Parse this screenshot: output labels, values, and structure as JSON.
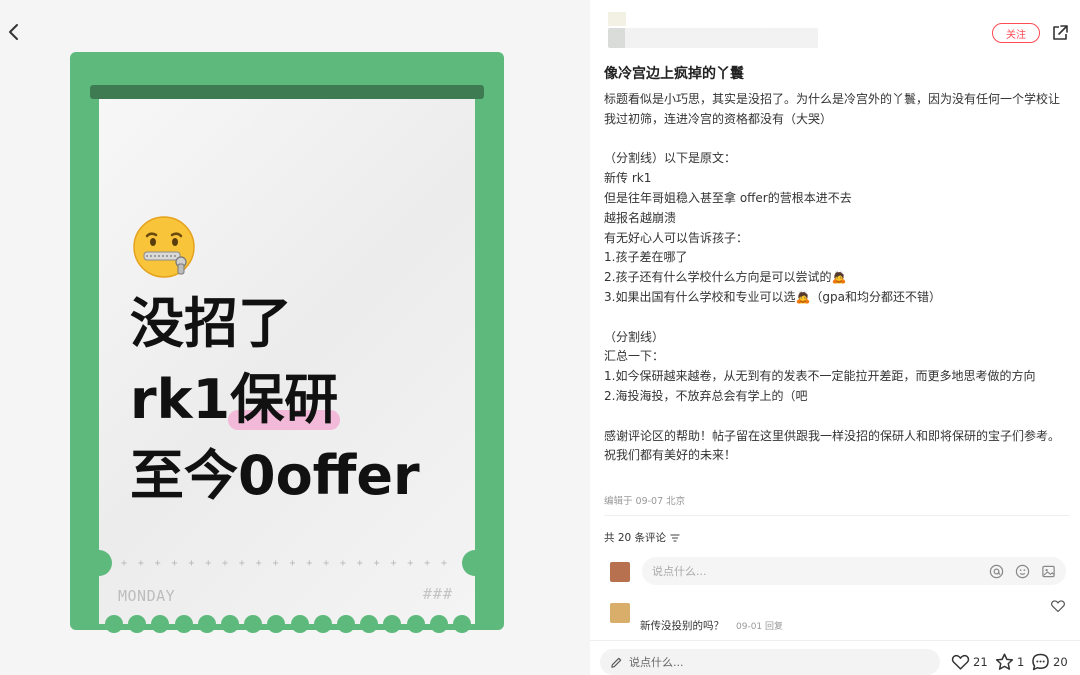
{
  "image_card": {
    "emoji": "🤐",
    "line1": "没招了",
    "line2_prefix": "rk1",
    "line2_highlight": "保研",
    "line3": "至今0offer",
    "plus_line": "+ + + + + + + + + + + + + + + + + + + + + + + + + + + + + + + + + + + + + + + + + + + +",
    "footer_left": "MONDAY",
    "footer_right": "###"
  },
  "header": {
    "follow_label": "关注"
  },
  "post": {
    "title": "像冷宫边上疯掉的丫鬟",
    "body": "标题看似是小巧思，其实是没招了。为什么是冷宫外的丫鬟，因为没有任何一个学校让我过初筛，连进冷宫的资格都没有（大哭）\n\n（分割线）以下是原文：\n新传 rk1\n但是往年哥姐稳入甚至拿 offer的营根本进不去\n越报名越崩溃\n有无好心人可以告诉孩子：\n1.孩子差在哪了\n2.孩子还有什么学校什么方向是可以尝试的🙇\n3.如果出国有什么学校和专业可以选🙇（gpa和均分都还不错）\n\n（分割线）\n汇总一下：\n1.如今保研越来越卷，从无到有的发表不一定能拉开差距，而更多地思考做的方向\n2.海投海投，不放弃总会有学上的（吧\n\n感谢评论区的帮助！帖子留在这里供跟我一样没招的保研人和即将保研的宝子们参考。祝我们都有美好的未来！",
    "meta": "编辑于 09-07 北京"
  },
  "comments": {
    "count_label": "共 20 条评论",
    "input_placeholder": "说点什么...",
    "items": [
      {
        "text": "新传没投别的吗？",
        "meta": "09-01 回复"
      }
    ]
  },
  "bottom_bar": {
    "input_placeholder": "说点什么...",
    "likes": "21",
    "stars": "1",
    "comments": "20"
  },
  "colors": {
    "card_green": "#5dba7c",
    "card_bar": "#3e7b52",
    "highlight_pink": "#f2b9d8",
    "follow_red": "#ff4b55"
  },
  "icons": [
    "back-icon",
    "share-icon",
    "filter-icon",
    "at-icon",
    "emoji-icon",
    "image-icon",
    "heart-icon",
    "star-icon",
    "comment-icon",
    "pencil-icon"
  ]
}
